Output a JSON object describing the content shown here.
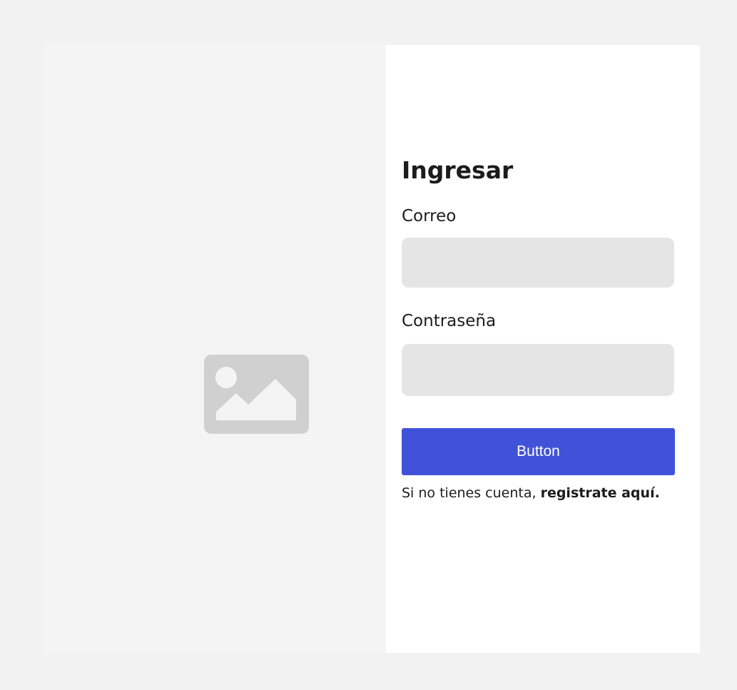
{
  "image_panel": {
    "icon": "image-placeholder-icon",
    "icon_color": "#d0d0d0"
  },
  "form": {
    "title": "Ingresar",
    "email": {
      "label": "Correo",
      "value": "",
      "placeholder": ""
    },
    "password": {
      "label": "Contraseña",
      "value": "",
      "placeholder": ""
    },
    "submit_label": "Button",
    "register_prompt": "Si no tienes cuenta,",
    "register_link": "registrate aquí."
  },
  "colors": {
    "page_background": "#f2f2f2",
    "image_panel_background": "#f4f4f4",
    "form_background": "#ffffff",
    "input_background": "#e5e5e5",
    "button_background": "#4053d8",
    "button_text": "#ffffff",
    "text": "#1c1c1c"
  }
}
